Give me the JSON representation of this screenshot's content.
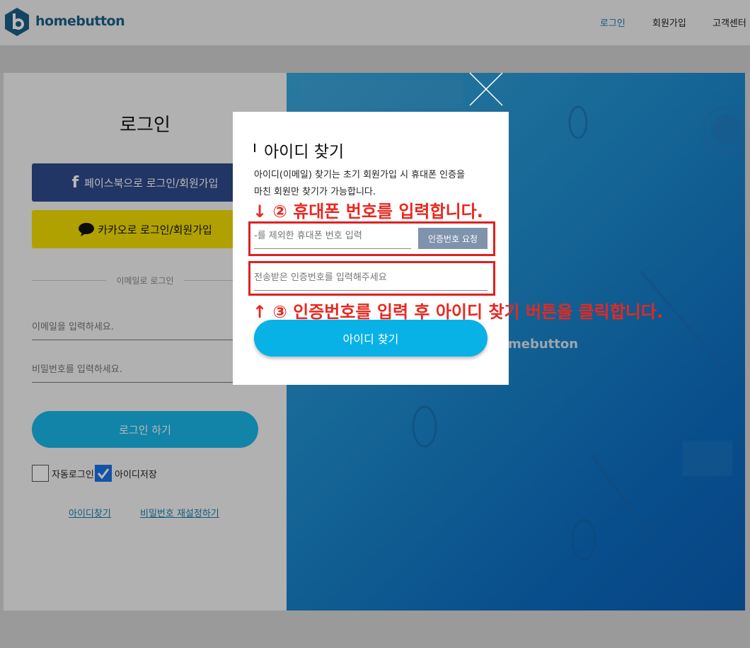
{
  "header": {
    "logo_text": "homebutton",
    "nav": [
      "로그인",
      "회원가입",
      "고객센터"
    ]
  },
  "login": {
    "title": "로그인",
    "facebook_label": "페이스북으로 로그인/회원가입",
    "kakao_label": "카카오로 로그인/회원가입",
    "divider_label": "이메일로 로그인",
    "email_placeholder": "이메일을 입력하세요.",
    "password_placeholder": "비밀번호를 입력하세요.",
    "submit_label": "로그인 하기",
    "auto_login_label": "자동로그인",
    "save_id_label": "아이디저장",
    "find_id_link": "아이디찾기",
    "reset_pw_link": "비밀번호 재설정하기"
  },
  "background": {
    "logo_text": "mebutton"
  },
  "modal": {
    "title": "아이디 찾기",
    "desc_line1": "아이디(이메일) 찾기는 초기 회원가입 시 휴대폰 인증을",
    "desc_line2": "마친 회원만 찾기가 가능합니다.",
    "phone_placeholder": "-를 제외한 휴대폰 번호 입력",
    "request_button": "인증번호 요청",
    "code_placeholder": "전송받은 인증번호를 입력해주세요",
    "submit_label": "아이디 찾기"
  },
  "annotations": {
    "step2": "↓ ② 휴대폰 번호를 입력합니다.",
    "step3": "↑ ③ 인증번호를 입력 후 아이디 찾기 버튼을 클릭합니다."
  },
  "colors": {
    "accent": "#09b2e6",
    "annotation_red": "#e8281f",
    "facebook": "#2f4b8c",
    "kakao": "#f6e000"
  }
}
